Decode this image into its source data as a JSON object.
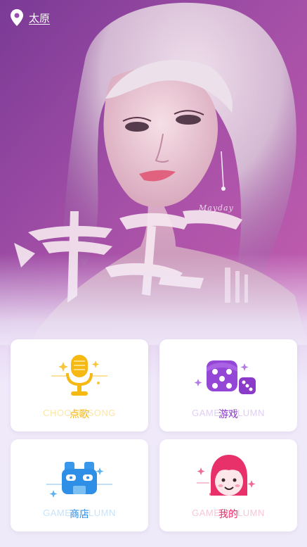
{
  "location": {
    "city": "太原"
  },
  "hero": {
    "caption": "Mayday"
  },
  "cards": [
    {
      "title": "点歌",
      "subtitle": "CHOOSE SONG",
      "accent": "#f5b80f",
      "subtitle_color": "#fbe6a8",
      "icon": "microphone-icon"
    },
    {
      "title": "游戏",
      "subtitle": "GAME COLUMN",
      "accent": "#8a3cc9",
      "subtitle_color": "#e1cff4",
      "icon": "dice-icon"
    },
    {
      "title": "商店",
      "subtitle": "GAME COLUMN",
      "accent": "#2f8ee6",
      "subtitle_color": "#c9e3f8",
      "icon": "shop-icon"
    },
    {
      "title": "我的",
      "subtitle": "GAME COLUMN",
      "accent": "#e8316b",
      "subtitle_color": "#f8c7d5",
      "icon": "avatar-icon"
    }
  ]
}
